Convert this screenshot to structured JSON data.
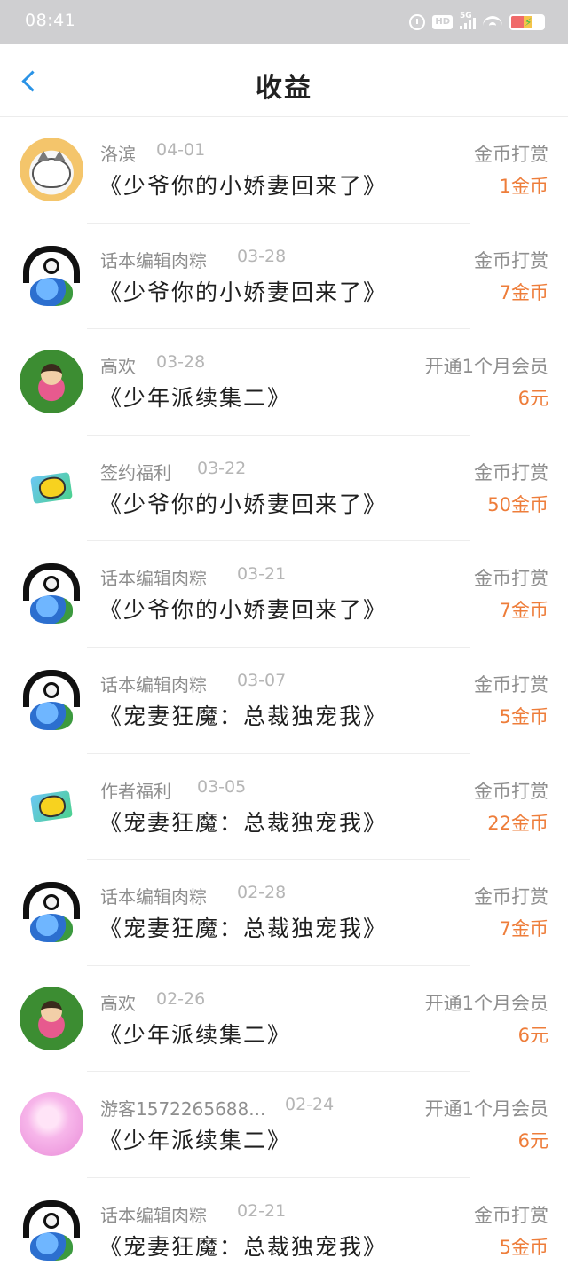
{
  "status_bar": {
    "time": "08:41",
    "hd": "HD",
    "network": "5G",
    "icons": [
      "alarm-icon",
      "hd-icon",
      "signal-icon",
      "wifi-icon",
      "battery-icon"
    ]
  },
  "header": {
    "title": "收益",
    "back_icon": "chevron-left-icon"
  },
  "colors": {
    "accent": "#2a93e6",
    "amount": "#ee7d3a",
    "muted": "#8e8e8e",
    "status_bar": "#cfcfd1"
  },
  "items": [
    {
      "avatar": "cat",
      "name": "洛滨",
      "date": "04-01",
      "book": "《少爷你的小娇妻回来了》",
      "type": "金币打赏",
      "amount": "1金币"
    },
    {
      "avatar": "globe",
      "name": "话本编辑肉粽",
      "date": "03-28",
      "book": "《少爷你的小娇妻回来了》",
      "type": "金币打赏",
      "amount": "7金币"
    },
    {
      "avatar": "kid",
      "name": "高欢",
      "date": "03-28",
      "book": "《少年派续集二》",
      "type": "开通1个月会员",
      "amount": "6元"
    },
    {
      "avatar": "emoji",
      "name": "签约福利",
      "date": "03-22",
      "book": "《少爷你的小娇妻回来了》",
      "type": "金币打赏",
      "amount": "50金币"
    },
    {
      "avatar": "globe",
      "name": "话本编辑肉粽",
      "date": "03-21",
      "book": "《少爷你的小娇妻回来了》",
      "type": "金币打赏",
      "amount": "7金币"
    },
    {
      "avatar": "globe",
      "name": "话本编辑肉粽",
      "date": "03-07",
      "book": "《宠妻狂魔：总裁独宠我》",
      "type": "金币打赏",
      "amount": "5金币"
    },
    {
      "avatar": "emoji",
      "name": "作者福利",
      "date": "03-05",
      "book": "《宠妻狂魔：总裁独宠我》",
      "type": "金币打赏",
      "amount": "22金币"
    },
    {
      "avatar": "globe",
      "name": "话本编辑肉粽",
      "date": "02-28",
      "book": "《宠妻狂魔：总裁独宠我》",
      "type": "金币打赏",
      "amount": "7金币"
    },
    {
      "avatar": "kid",
      "name": "高欢",
      "date": "02-26",
      "book": "《少年派续集二》",
      "type": "开通1个月会员",
      "amount": "6元"
    },
    {
      "avatar": "pink",
      "name": "游客1572265688...",
      "date": "02-24",
      "book": "《少年派续集二》",
      "type": "开通1个月会员",
      "amount": "6元"
    },
    {
      "avatar": "globe",
      "name": "话本编辑肉粽",
      "date": "02-21",
      "book": "《宠妻狂魔：总裁独宠我》",
      "type": "金币打赏",
      "amount": "5金币"
    }
  ]
}
